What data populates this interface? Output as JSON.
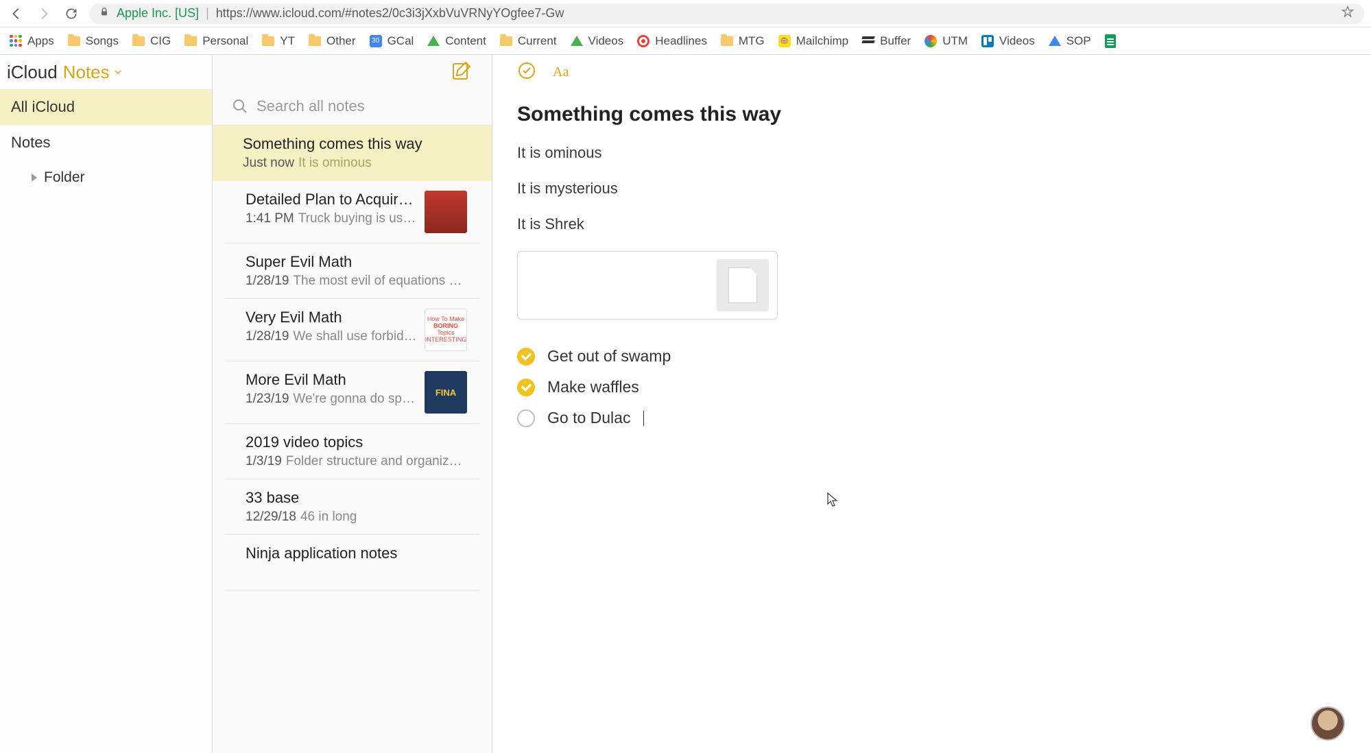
{
  "browser": {
    "org": "Apple Inc. [US]",
    "url": "https://www.icloud.com/#notes2/0c3i3jXxbVuVRNyYOgfee7-Gw"
  },
  "bookmarks": [
    {
      "label": "Apps",
      "icon": "apps"
    },
    {
      "label": "Songs",
      "icon": "folder"
    },
    {
      "label": "CIG",
      "icon": "folder"
    },
    {
      "label": "Personal",
      "icon": "folder"
    },
    {
      "label": "YT",
      "icon": "folder"
    },
    {
      "label": "Other",
      "icon": "folder"
    },
    {
      "label": "GCal",
      "icon": "gcal"
    },
    {
      "label": "Content",
      "icon": "gdrive"
    },
    {
      "label": "Current",
      "icon": "folder"
    },
    {
      "label": "Videos",
      "icon": "gdrive"
    },
    {
      "label": "Headlines",
      "icon": "target"
    },
    {
      "label": "MTG",
      "icon": "folder"
    },
    {
      "label": "Mailchimp",
      "icon": "mailchimp"
    },
    {
      "label": "Buffer",
      "icon": "buffer"
    },
    {
      "label": "UTM",
      "icon": "utm"
    },
    {
      "label": "Videos",
      "icon": "trello"
    },
    {
      "label": "SOP",
      "icon": "gdriveblue"
    },
    {
      "label": "",
      "icon": "sheets"
    }
  ],
  "app_header": {
    "brand": "iCloud",
    "section": "Notes"
  },
  "folders": [
    {
      "label": "All iCloud",
      "selected": true
    },
    {
      "label": "Notes"
    },
    {
      "label": "Folder",
      "indent": true,
      "caret": true
    }
  ],
  "search": {
    "placeholder": "Search all notes"
  },
  "notes": [
    {
      "title": "Something comes this way",
      "time": "Just now",
      "preview": "It is ominous",
      "selected": true
    },
    {
      "title": "Detailed Plan to Acquire a F…",
      "time": "1:41 PM",
      "preview": "Truck buying is usually …",
      "thumb": "spider"
    },
    {
      "title": "Super Evil Math",
      "time": "1/28/19",
      "preview": "The most evil of equations shal…"
    },
    {
      "title": "Very Evil Math",
      "time": "1/28/19",
      "preview": "We shall use forbidden …",
      "thumb": "boring"
    },
    {
      "title": "More Evil Math",
      "time": "1/23/19",
      "preview": "We're gonna do spells, …",
      "thumb": "fina"
    },
    {
      "title": "2019 video topics",
      "time": "1/3/19",
      "preview": "Folder structure and organization"
    },
    {
      "title": "33 base",
      "time": "12/29/18",
      "preview": "46 in long"
    },
    {
      "title": "Ninja application notes",
      "time": "",
      "preview": ""
    }
  ],
  "note": {
    "title": "Something comes this way",
    "paragraphs": [
      "It is ominous",
      "It is mysterious",
      "It is Shrek"
    ],
    "checklist": [
      {
        "text": "Get out of swamp",
        "checked": true
      },
      {
        "text": "Make waffles",
        "checked": true
      },
      {
        "text": "Go to Dulac",
        "checked": false,
        "cursor": true
      }
    ]
  }
}
